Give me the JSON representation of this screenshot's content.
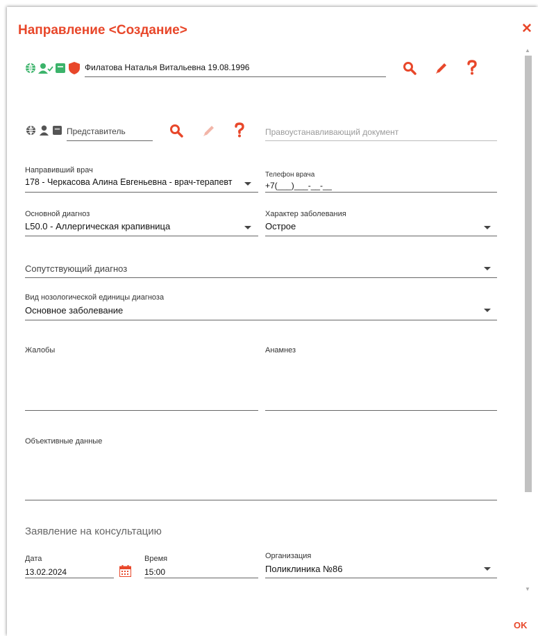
{
  "dialog": {
    "title": "Направление <Создание>",
    "close_symbol": "✕",
    "ok_label": "OK"
  },
  "patient": {
    "value": "Филатова Наталья Витальевна 19.08.1996",
    "icons": [
      "globe-icon",
      "user-check-icon",
      "card-icon",
      "shield-icon"
    ]
  },
  "representative": {
    "placeholder": "Представитель",
    "document_placeholder": "Правоустанавливающий документ",
    "icons": [
      "globe-icon",
      "user-icon",
      "card-icon"
    ]
  },
  "doctor": {
    "label": "Направивший врач",
    "value": "178 - Черкасова Алина Евгеньевна - врач-терапевт",
    "phone_label": "Телефон врача",
    "phone_value": "+7(___)___-__-__"
  },
  "diagnosis": {
    "label": "Основной диагноз",
    "value": "L50.0 - Аллергическая крапивница",
    "character_label": "Характер заболевания",
    "character_value": "Острое",
    "concomitant_placeholder": "Сопутствующий диагноз",
    "nosology_label": "Вид нозологической единицы диагноза",
    "nosology_value": "Основное заболевание"
  },
  "complaints": {
    "label": "Жалобы"
  },
  "anamnesis": {
    "label": "Анамнез"
  },
  "objective": {
    "label": "Объективные данные"
  },
  "consultation": {
    "section_title": "Заявление на консультацию",
    "date_label": "Дата",
    "date_value": "13.02.2024",
    "time_label": "Время",
    "time_value": "15:00",
    "org_label": "Организация",
    "org_value": "Поликлиника №86"
  },
  "colors": {
    "accent": "#e8472a",
    "green": "#3bb36a",
    "gray_icon": "#555555"
  }
}
